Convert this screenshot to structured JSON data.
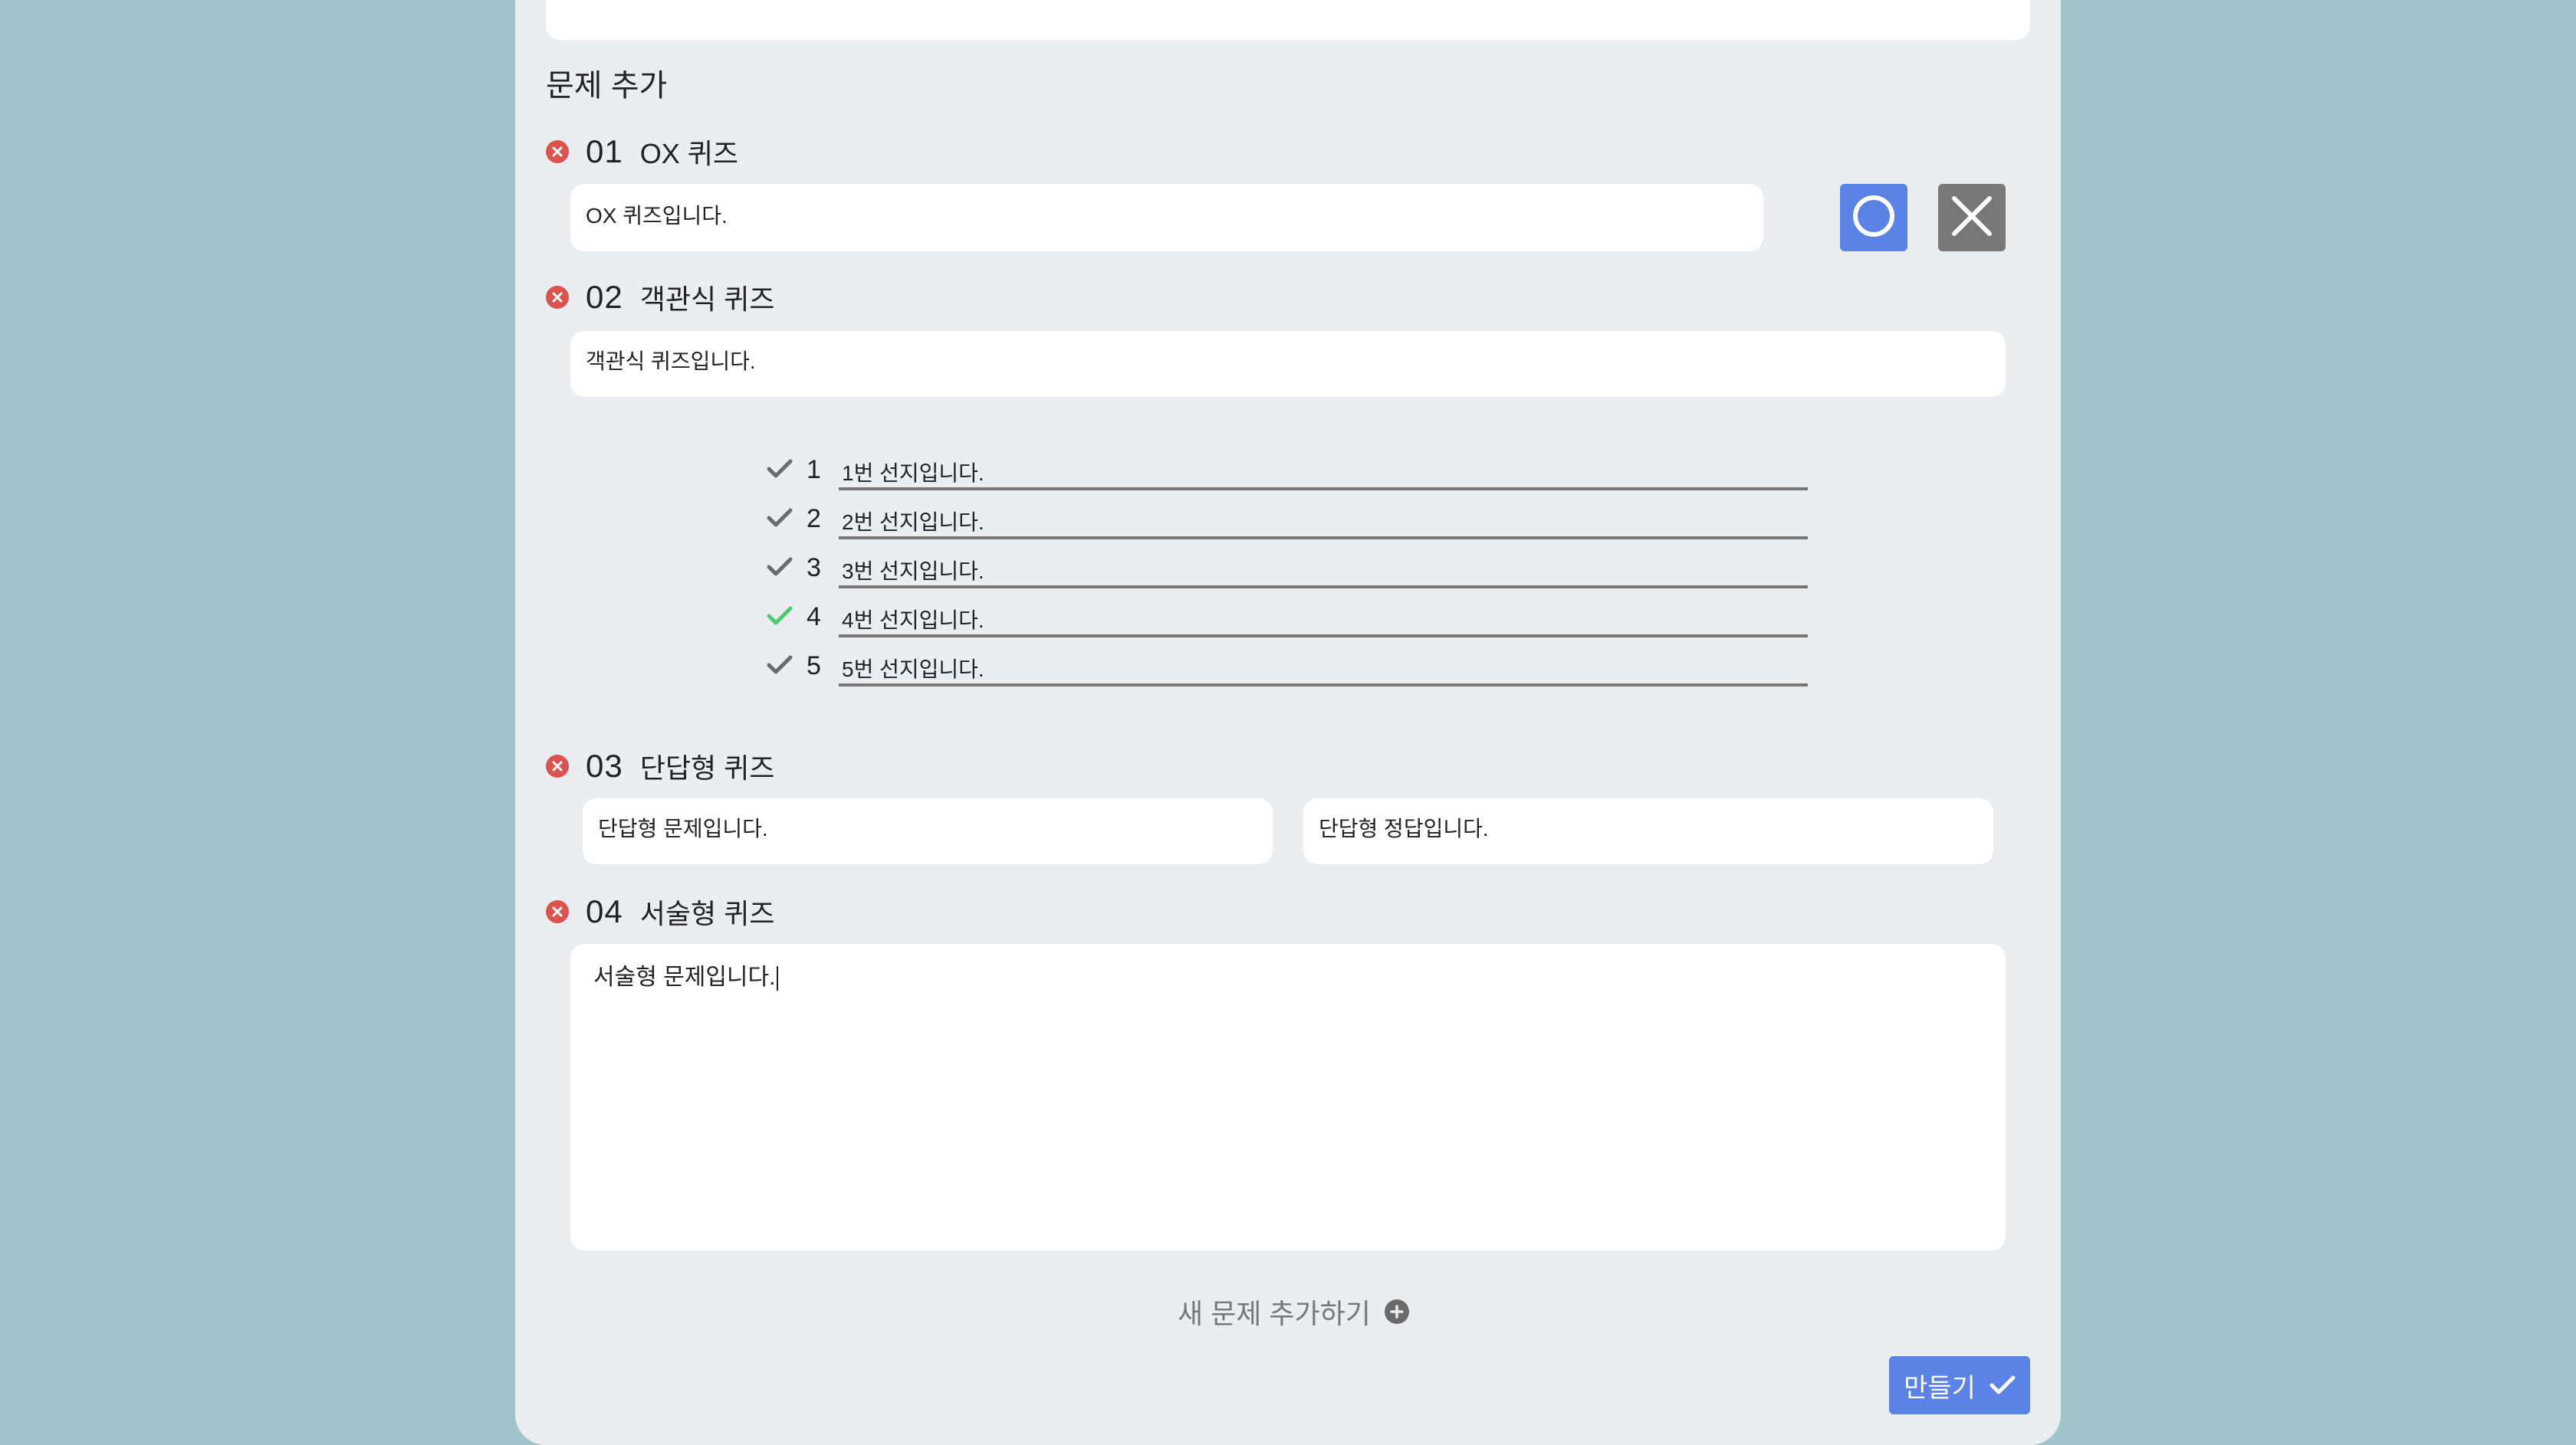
{
  "section_title": "문제 추가",
  "questions": [
    {
      "number": "01",
      "type_label": "OX 퀴즈",
      "question_text": "OX 퀴즈입니다.",
      "o_icon": "circle-o-icon",
      "x_icon": "x-mark-icon"
    },
    {
      "number": "02",
      "type_label": "객관식 퀴즈",
      "question_text": "객관식 퀴즈입니다.",
      "choices": [
        {
          "num": "1",
          "text": "1번 선지입니다.",
          "correct": false
        },
        {
          "num": "2",
          "text": "2번 선지입니다.",
          "correct": false
        },
        {
          "num": "3",
          "text": "3번 선지입니다.",
          "correct": false
        },
        {
          "num": "4",
          "text": "4번 선지입니다.",
          "correct": true
        },
        {
          "num": "5",
          "text": "5번 선지입니다.",
          "correct": false
        }
      ]
    },
    {
      "number": "03",
      "type_label": "단답형 퀴즈",
      "question_text": "단답형 문제입니다.",
      "answer_text": "단답형 정답입니다."
    },
    {
      "number": "04",
      "type_label": "서술형 퀴즈",
      "question_text": "서술형 문제입니다."
    }
  ],
  "add_question_label": "새 문제 추가하기",
  "make_button_label": "만들기",
  "colors": {
    "background": "#a0c4cb",
    "panel": "#eaeef0",
    "accent_blue": "#5b82e6",
    "remove_red": "#d9534f",
    "correct_green": "#4fc86b",
    "neutral_check": "#6b6b6b"
  }
}
